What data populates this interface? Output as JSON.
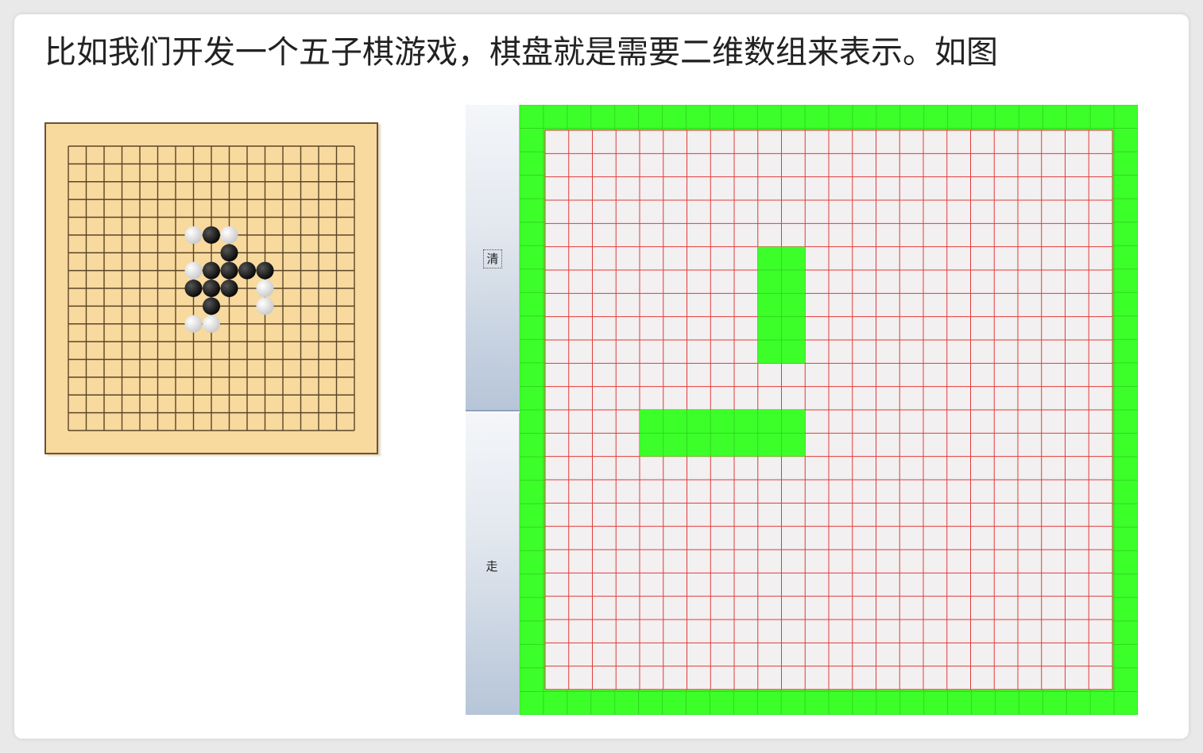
{
  "caption": "比如我们开发一个五子棋游戏，棋盘就是需要二维数组来表示。如图",
  "gomoku": {
    "grid_lines": 17,
    "black_stones": [
      [
        8,
        5
      ],
      [
        9,
        6
      ],
      [
        8,
        7
      ],
      [
        9,
        7
      ],
      [
        10,
        7
      ],
      [
        11,
        7
      ],
      [
        7,
        8
      ],
      [
        8,
        8
      ],
      [
        9,
        8
      ],
      [
        8,
        9
      ]
    ],
    "white_stones": [
      [
        7,
        5
      ],
      [
        7,
        7
      ],
      [
        11,
        8
      ],
      [
        11,
        9
      ],
      [
        7,
        10
      ],
      [
        8,
        10
      ],
      [
        9,
        5
      ]
    ]
  },
  "snake_panel": {
    "buttons": [
      {
        "label": "清"
      },
      {
        "label": "走"
      }
    ],
    "colors": {
      "wall": "#3cff2a",
      "cell_bg": "#f2f0f0",
      "grid_line": "#e23b3b"
    },
    "grid": {
      "cols": 24,
      "rows": 24
    },
    "green_blocks": [
      {
        "col": 9,
        "row": 5,
        "cols": 2,
        "rows": 5
      },
      {
        "col": 4,
        "row": 12,
        "cols": 7,
        "rows": 2
      }
    ]
  }
}
